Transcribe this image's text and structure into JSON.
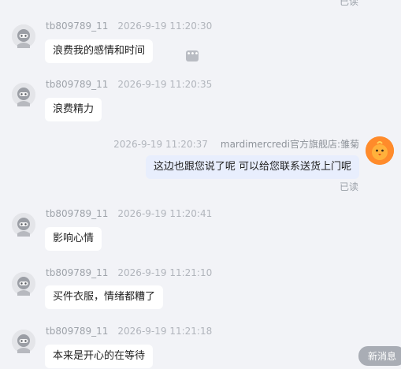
{
  "top_read_status": "已读",
  "messages": [
    {
      "sender": "tb809789_11",
      "time": "2026-9-19 11:20:30",
      "text": "浪费我的感情和时间",
      "more_icon": "ellipsis-icon"
    },
    {
      "sender": "tb809789_11",
      "time": "2026-9-19 11:20:35",
      "text": "浪费精力"
    },
    {
      "sender": "mardimercredi官方旗舰店:雏菊",
      "time": "2026-9-19 11:20:37",
      "text": "这边也跟您说了呢  可以给您联系送货上门呢",
      "status": "已读"
    },
    {
      "sender": "tb809789_11",
      "time": "2026-9-19 11:20:41",
      "text": "影响心情"
    },
    {
      "sender": "tb809789_11",
      "time": "2026-9-19 11:21:10",
      "text": "买件衣服，情绪都糟了"
    },
    {
      "sender": "tb809789_11",
      "time": "2026-9-19 11:21:18",
      "text": "本来是开心的在等待"
    }
  ],
  "new_message_button": "新消息",
  "colors": {
    "background": "#f2f3f7",
    "own_bubble": "#e8eefd",
    "shop_avatar": "#ff8b2b"
  }
}
